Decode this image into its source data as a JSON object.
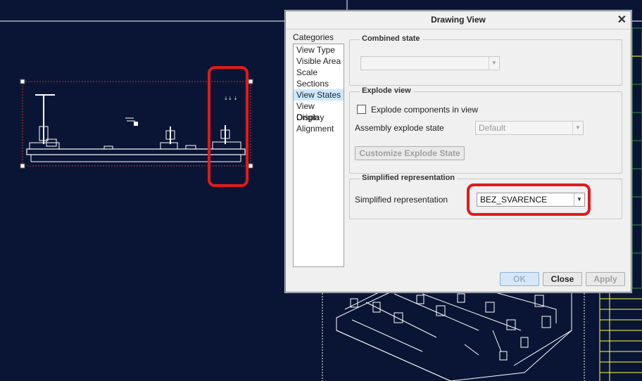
{
  "dialog": {
    "title": "Drawing View",
    "categories_label": "Categories",
    "categories": [
      {
        "label": "View Type",
        "selected": false
      },
      {
        "label": "Visible Area",
        "selected": false
      },
      {
        "label": "Scale",
        "selected": false
      },
      {
        "label": "Sections",
        "selected": false
      },
      {
        "label": "View States",
        "selected": true
      },
      {
        "label": "View Display",
        "selected": false
      },
      {
        "label": "Origin",
        "selected": false
      },
      {
        "label": "Alignment",
        "selected": false
      }
    ],
    "combined_state": {
      "title": "Combined state",
      "value": ""
    },
    "explode_view": {
      "title": "Explode view",
      "checkbox_label": "Explode components in view",
      "checked": false,
      "assembly_label": "Assembly explode state",
      "assembly_value": "Default",
      "customize_button": "Customize Explode State"
    },
    "simplified": {
      "title": "Simplified representation",
      "label": "Simplified representation",
      "value": "BEZ_SVARENCE"
    },
    "buttons": {
      "ok": "OK",
      "close": "Close",
      "apply": "Apply"
    }
  },
  "colors": {
    "background": "#0a1535",
    "highlight": "#e21a1a",
    "selection": "#cde8ff"
  }
}
